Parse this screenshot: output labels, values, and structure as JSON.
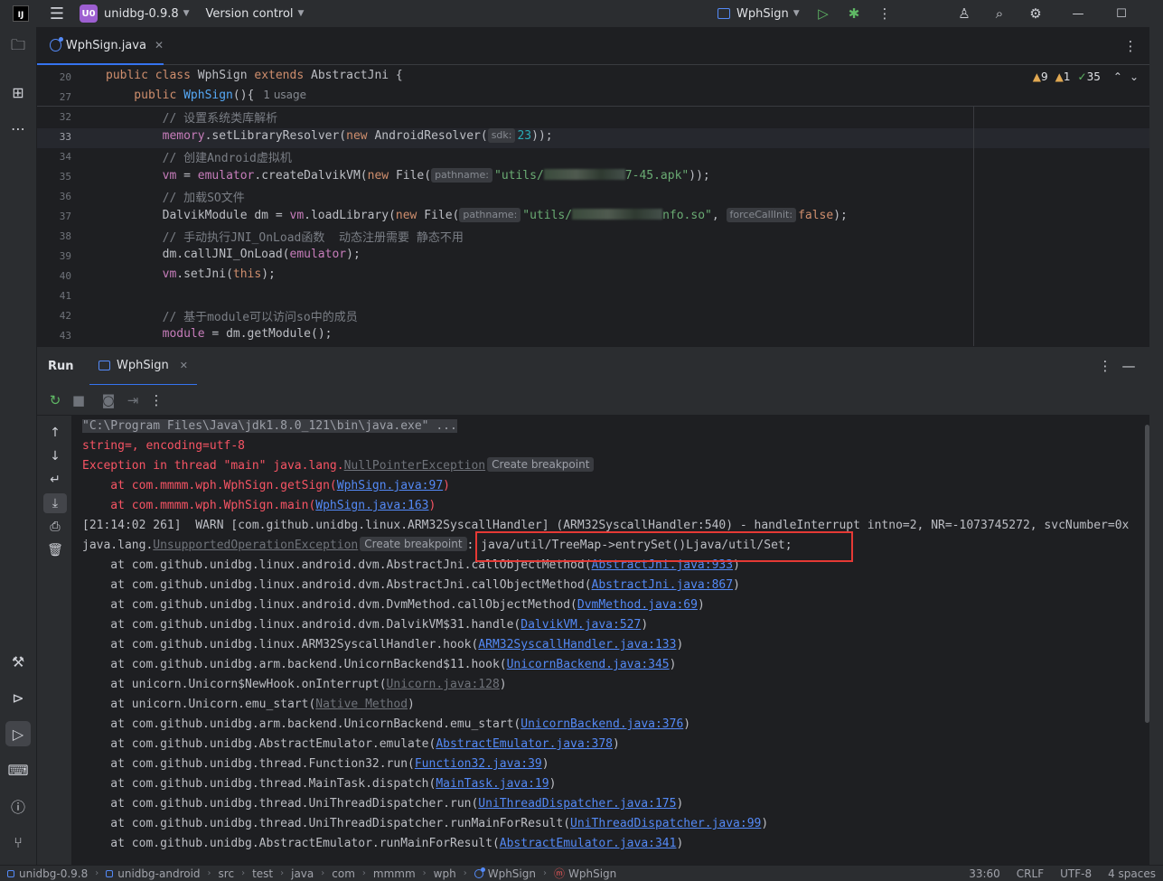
{
  "titlebar": {
    "logo_text": "IJ",
    "project_badge": "U0",
    "project_name": "unidbg-0.9.8",
    "vcs": "Version control",
    "run_config": "WphSign"
  },
  "editor": {
    "tab_label": "WphSign.java",
    "sticky": [
      {
        "num": "20",
        "tokens": [
          [
            "kw",
            "public class "
          ],
          [
            "cls",
            "WphSign "
          ],
          [
            "kw",
            "extends "
          ],
          [
            "cls",
            "AbstractJni {"
          ]
        ]
      },
      {
        "num": "27",
        "tokens": [
          [
            "kw",
            "    public "
          ],
          [
            "mth",
            "WphSign"
          ],
          [
            "cls",
            "(){"
          ]
        ],
        "usage": "1 usage"
      }
    ],
    "inspections": {
      "warnings": "9",
      "weak": "1",
      "ok": "35"
    },
    "lines": [
      {
        "num": "32",
        "comment": "        // 设置系统类库解析"
      },
      {
        "num": "33"
      },
      {
        "num": "34",
        "comment": "        // 创建Android虚拟机"
      },
      {
        "num": "35"
      },
      {
        "num": "36",
        "comment": "        // 加载SO文件"
      },
      {
        "num": "37"
      },
      {
        "num": "38",
        "comment": "        // 手动执行JNI_OnLoad函数  动态注册需要 静态不用"
      },
      {
        "num": "39"
      },
      {
        "num": "40"
      },
      {
        "num": "41"
      },
      {
        "num": "42",
        "comment": "        // 基于module可以访问so中的成员"
      },
      {
        "num": "43"
      }
    ],
    "hints": {
      "sdk": "sdk:",
      "pathname": "pathname:",
      "forceCallInit": "forceCallInit:"
    },
    "strings": {
      "apk_pre": "\"utils/",
      "apk_post": "7-45.apk\"",
      "so_pre": "\"utils/",
      "so_post": "nfo.so\""
    }
  },
  "run": {
    "title": "Run",
    "tab": "WphSign",
    "console": [
      {
        "type": "cmd",
        "text": "\"C:\\Program Files\\Java\\jdk1.8.0_121\\bin\\java.exe\" ..."
      },
      {
        "type": "err",
        "text": "string=, encoding=utf-8"
      },
      {
        "type": "err_exc",
        "pre": "Exception in thread \"main\" java.lang.",
        "link": "NullPointerException",
        "bp": "Create breakpoint"
      },
      {
        "type": "err_at",
        "pre": "    at com.mmmm.wph.WphSign.getSign(",
        "link": "WphSign.java:97",
        "post": ")"
      },
      {
        "type": "err_at",
        "pre": "    at com.mmmm.wph.WphSign.main(",
        "link": "WphSign.java:163",
        "post": ")"
      },
      {
        "type": "plain",
        "text": "[21:14:02 261]  WARN [com.github.unidbg.linux.ARM32SyscallHandler] (ARM32SyscallHandler:540) - handleInterrupt intno=2, NR=-1073745272, svcNumber=0x"
      },
      {
        "type": "unsup",
        "pre": "java.lang.",
        "link": "UnsupportedOperationException",
        "bp": "Create breakpoint",
        "post": ": java/util/TreeMap->entrySet()Ljava/util/Set;"
      },
      {
        "type": "at",
        "pre": "    at com.github.unidbg.linux.android.dvm.AbstractJni.callObjectMethod(",
        "link": "AbstractJni.java:933",
        "post": ")"
      },
      {
        "type": "at",
        "pre": "    at com.github.unidbg.linux.android.dvm.AbstractJni.callObjectMethod(",
        "link": "AbstractJni.java:867",
        "post": ")"
      },
      {
        "type": "at",
        "pre": "    at com.github.unidbg.linux.android.dvm.DvmMethod.callObjectMethod(",
        "link": "DvmMethod.java:69",
        "post": ")"
      },
      {
        "type": "at",
        "pre": "    at com.github.unidbg.linux.android.dvm.DalvikVM$31.handle(",
        "link": "DalvikVM.java:527",
        "post": ")"
      },
      {
        "type": "at",
        "pre": "    at com.github.unidbg.linux.ARM32SyscallHandler.hook(",
        "link": "ARM32SyscallHandler.java:133",
        "post": ")"
      },
      {
        "type": "at",
        "pre": "    at com.github.unidbg.arm.backend.UnicornBackend$11.hook(",
        "link": "UnicornBackend.java:345",
        "post": ")"
      },
      {
        "type": "at_gray",
        "pre": "    at unicorn.Unicorn$NewHook.onInterrupt(",
        "link": "Unicorn.java:128",
        "post": ")"
      },
      {
        "type": "at_gray",
        "pre": "    at unicorn.Unicorn.emu_start(",
        "link": "Native Method",
        "post": ")"
      },
      {
        "type": "at",
        "pre": "    at com.github.unidbg.arm.backend.UnicornBackend.emu_start(",
        "link": "UnicornBackend.java:376",
        "post": ")"
      },
      {
        "type": "at",
        "pre": "    at com.github.unidbg.AbstractEmulator.emulate(",
        "link": "AbstractEmulator.java:378",
        "post": ")"
      },
      {
        "type": "at",
        "pre": "    at com.github.unidbg.thread.Function32.run(",
        "link": "Function32.java:39",
        "post": ")"
      },
      {
        "type": "at",
        "pre": "    at com.github.unidbg.thread.MainTask.dispatch(",
        "link": "MainTask.java:19",
        "post": ")"
      },
      {
        "type": "at",
        "pre": "    at com.github.unidbg.thread.UniThreadDispatcher.run(",
        "link": "UniThreadDispatcher.java:175",
        "post": ")"
      },
      {
        "type": "at",
        "pre": "    at com.github.unidbg.thread.UniThreadDispatcher.runMainForResult(",
        "link": "UniThreadDispatcher.java:99",
        "post": ")"
      },
      {
        "type": "at",
        "pre": "    at com.github.unidbg.AbstractEmulator.runMainForResult(",
        "link": "AbstractEmulator.java:341",
        "post": ")"
      }
    ]
  },
  "statusbar": {
    "crumbs": [
      "unidbg-0.9.8",
      "unidbg-android",
      "src",
      "test",
      "java",
      "com",
      "mmmm",
      "wph",
      "WphSign",
      "WphSign"
    ],
    "position": "33:60",
    "line_sep": "CRLF",
    "encoding": "UTF-8",
    "indent": "4 spaces"
  },
  "colors": {
    "accent": "#3574f0",
    "error": "#f75464",
    "link": "#548af7",
    "highlight_box": "#e53935"
  }
}
